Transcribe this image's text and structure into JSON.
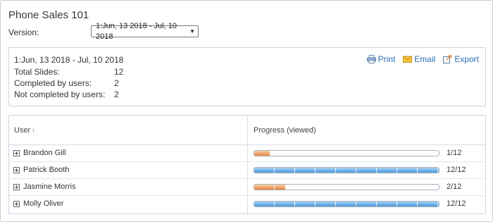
{
  "page": {
    "title": "Phone Sales 101",
    "version_label": "Version:",
    "version_selected": "1:Jun, 13 2018 - Jul, 10 2018"
  },
  "summary": {
    "range": "1:Jun, 13 2018 - Jul, 10 2018",
    "stats": [
      {
        "label": "Total Slides:",
        "value": "12"
      },
      {
        "label": "Completed by users:",
        "value": "2"
      },
      {
        "label": "Not completed by users:",
        "value": "2"
      }
    ],
    "actions": [
      {
        "label": "Print",
        "icon": "printer-icon"
      },
      {
        "label": "Email",
        "icon": "envelope-icon"
      },
      {
        "label": "Export",
        "icon": "export-icon"
      }
    ]
  },
  "table": {
    "columns": {
      "user": "User",
      "progress": "Progress (viewed)"
    },
    "sort_indicator": "↑",
    "rows": [
      {
        "name": "Brandon Gill",
        "viewed": 1,
        "total": 12,
        "count_text": "1/12",
        "color": "orange"
      },
      {
        "name": "Patrick Booth",
        "viewed": 12,
        "total": 12,
        "count_text": "12/12",
        "color": "blue"
      },
      {
        "name": "Jasmine Morris",
        "viewed": 2,
        "total": 12,
        "count_text": "2/12",
        "color": "orange"
      },
      {
        "name": "Molly Oliver",
        "viewed": 12,
        "total": 12,
        "count_text": "12/12",
        "color": "blue"
      }
    ]
  },
  "colors": {
    "link": "#2a6fb8",
    "incomplete": "#e8843f",
    "complete": "#4a98dc"
  }
}
